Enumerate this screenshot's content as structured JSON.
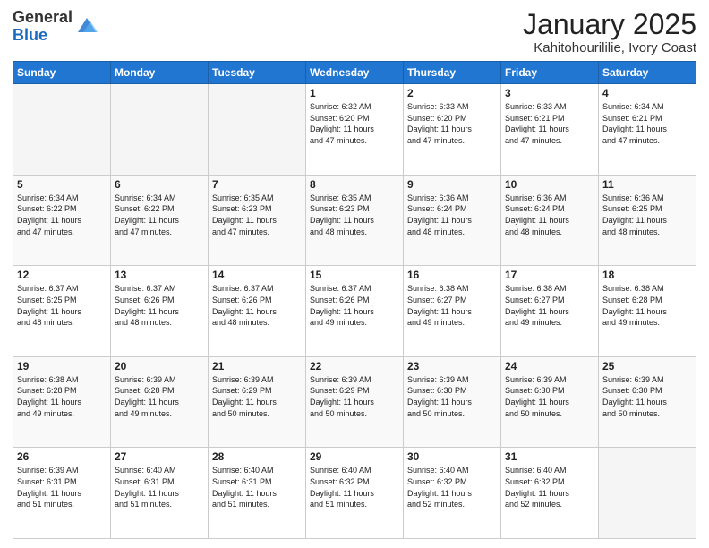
{
  "logo": {
    "general": "General",
    "blue": "Blue"
  },
  "header": {
    "month": "January 2025",
    "location": "Kahitohourililie, Ivory Coast"
  },
  "weekdays": [
    "Sunday",
    "Monday",
    "Tuesday",
    "Wednesday",
    "Thursday",
    "Friday",
    "Saturday"
  ],
  "weeks": [
    [
      {
        "day": "",
        "info": ""
      },
      {
        "day": "",
        "info": ""
      },
      {
        "day": "",
        "info": ""
      },
      {
        "day": "1",
        "info": "Sunrise: 6:32 AM\nSunset: 6:20 PM\nDaylight: 11 hours\nand 47 minutes."
      },
      {
        "day": "2",
        "info": "Sunrise: 6:33 AM\nSunset: 6:20 PM\nDaylight: 11 hours\nand 47 minutes."
      },
      {
        "day": "3",
        "info": "Sunrise: 6:33 AM\nSunset: 6:21 PM\nDaylight: 11 hours\nand 47 minutes."
      },
      {
        "day": "4",
        "info": "Sunrise: 6:34 AM\nSunset: 6:21 PM\nDaylight: 11 hours\nand 47 minutes."
      }
    ],
    [
      {
        "day": "5",
        "info": "Sunrise: 6:34 AM\nSunset: 6:22 PM\nDaylight: 11 hours\nand 47 minutes."
      },
      {
        "day": "6",
        "info": "Sunrise: 6:34 AM\nSunset: 6:22 PM\nDaylight: 11 hours\nand 47 minutes."
      },
      {
        "day": "7",
        "info": "Sunrise: 6:35 AM\nSunset: 6:23 PM\nDaylight: 11 hours\nand 47 minutes."
      },
      {
        "day": "8",
        "info": "Sunrise: 6:35 AM\nSunset: 6:23 PM\nDaylight: 11 hours\nand 48 minutes."
      },
      {
        "day": "9",
        "info": "Sunrise: 6:36 AM\nSunset: 6:24 PM\nDaylight: 11 hours\nand 48 minutes."
      },
      {
        "day": "10",
        "info": "Sunrise: 6:36 AM\nSunset: 6:24 PM\nDaylight: 11 hours\nand 48 minutes."
      },
      {
        "day": "11",
        "info": "Sunrise: 6:36 AM\nSunset: 6:25 PM\nDaylight: 11 hours\nand 48 minutes."
      }
    ],
    [
      {
        "day": "12",
        "info": "Sunrise: 6:37 AM\nSunset: 6:25 PM\nDaylight: 11 hours\nand 48 minutes."
      },
      {
        "day": "13",
        "info": "Sunrise: 6:37 AM\nSunset: 6:26 PM\nDaylight: 11 hours\nand 48 minutes."
      },
      {
        "day": "14",
        "info": "Sunrise: 6:37 AM\nSunset: 6:26 PM\nDaylight: 11 hours\nand 48 minutes."
      },
      {
        "day": "15",
        "info": "Sunrise: 6:37 AM\nSunset: 6:26 PM\nDaylight: 11 hours\nand 49 minutes."
      },
      {
        "day": "16",
        "info": "Sunrise: 6:38 AM\nSunset: 6:27 PM\nDaylight: 11 hours\nand 49 minutes."
      },
      {
        "day": "17",
        "info": "Sunrise: 6:38 AM\nSunset: 6:27 PM\nDaylight: 11 hours\nand 49 minutes."
      },
      {
        "day": "18",
        "info": "Sunrise: 6:38 AM\nSunset: 6:28 PM\nDaylight: 11 hours\nand 49 minutes."
      }
    ],
    [
      {
        "day": "19",
        "info": "Sunrise: 6:38 AM\nSunset: 6:28 PM\nDaylight: 11 hours\nand 49 minutes."
      },
      {
        "day": "20",
        "info": "Sunrise: 6:39 AM\nSunset: 6:28 PM\nDaylight: 11 hours\nand 49 minutes."
      },
      {
        "day": "21",
        "info": "Sunrise: 6:39 AM\nSunset: 6:29 PM\nDaylight: 11 hours\nand 50 minutes."
      },
      {
        "day": "22",
        "info": "Sunrise: 6:39 AM\nSunset: 6:29 PM\nDaylight: 11 hours\nand 50 minutes."
      },
      {
        "day": "23",
        "info": "Sunrise: 6:39 AM\nSunset: 6:30 PM\nDaylight: 11 hours\nand 50 minutes."
      },
      {
        "day": "24",
        "info": "Sunrise: 6:39 AM\nSunset: 6:30 PM\nDaylight: 11 hours\nand 50 minutes."
      },
      {
        "day": "25",
        "info": "Sunrise: 6:39 AM\nSunset: 6:30 PM\nDaylight: 11 hours\nand 50 minutes."
      }
    ],
    [
      {
        "day": "26",
        "info": "Sunrise: 6:39 AM\nSunset: 6:31 PM\nDaylight: 11 hours\nand 51 minutes."
      },
      {
        "day": "27",
        "info": "Sunrise: 6:40 AM\nSunset: 6:31 PM\nDaylight: 11 hours\nand 51 minutes."
      },
      {
        "day": "28",
        "info": "Sunrise: 6:40 AM\nSunset: 6:31 PM\nDaylight: 11 hours\nand 51 minutes."
      },
      {
        "day": "29",
        "info": "Sunrise: 6:40 AM\nSunset: 6:32 PM\nDaylight: 11 hours\nand 51 minutes."
      },
      {
        "day": "30",
        "info": "Sunrise: 6:40 AM\nSunset: 6:32 PM\nDaylight: 11 hours\nand 52 minutes."
      },
      {
        "day": "31",
        "info": "Sunrise: 6:40 AM\nSunset: 6:32 PM\nDaylight: 11 hours\nand 52 minutes."
      },
      {
        "day": "",
        "info": ""
      }
    ]
  ]
}
